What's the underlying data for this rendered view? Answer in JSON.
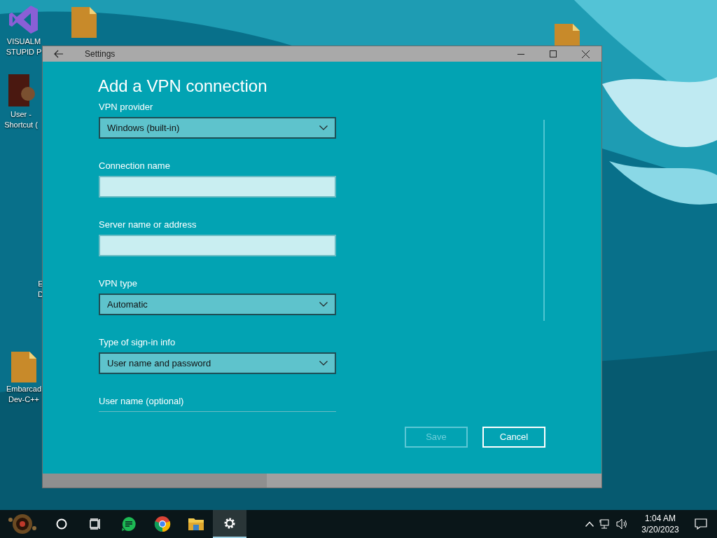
{
  "desktop_icons": [
    {
      "kind": "vs",
      "lines": [
        "VISUALM",
        "STUPID P"
      ]
    },
    {
      "kind": "doc"
    },
    {
      "kind": "user",
      "lines": [
        "User -",
        "Shortcut ("
      ]
    },
    {
      "kind": "none",
      "lines": [
        "E",
        "D"
      ]
    },
    {
      "kind": "doc",
      "lines": [
        "Embarcad",
        "Dev-C++"
      ]
    },
    {
      "kind": "doc"
    }
  ],
  "window": {
    "title": "Settings",
    "heading": "Add a VPN connection"
  },
  "fields": [
    {
      "label": "VPN provider",
      "kind": "dropdown",
      "value": "Windows (built-in)"
    },
    {
      "label": "Connection name",
      "kind": "text"
    },
    {
      "label": "Server name or address",
      "kind": "text"
    },
    {
      "label": "VPN type",
      "kind": "dropdown",
      "value": "Automatic"
    },
    {
      "label": "Type of sign-in info",
      "kind": "dropdown",
      "value": "User name and password"
    },
    {
      "label": "User name (optional)",
      "kind": "text"
    }
  ],
  "buttons": [
    {
      "label": "Save",
      "disabled": true
    },
    {
      "label": "Cancel",
      "disabled": false
    }
  ],
  "taskbar": {
    "apps": [
      {
        "kind": "cortana",
        "selected": false
      },
      {
        "kind": "taskview",
        "selected": false
      },
      {
        "kind": "notes",
        "selected": false
      },
      {
        "kind": "chrome",
        "selected": false
      },
      {
        "kind": "explorer",
        "selected": false
      },
      {
        "kind": "settings",
        "selected": true
      }
    ],
    "time": "1:04 AM",
    "date": "3/20/2023"
  }
}
